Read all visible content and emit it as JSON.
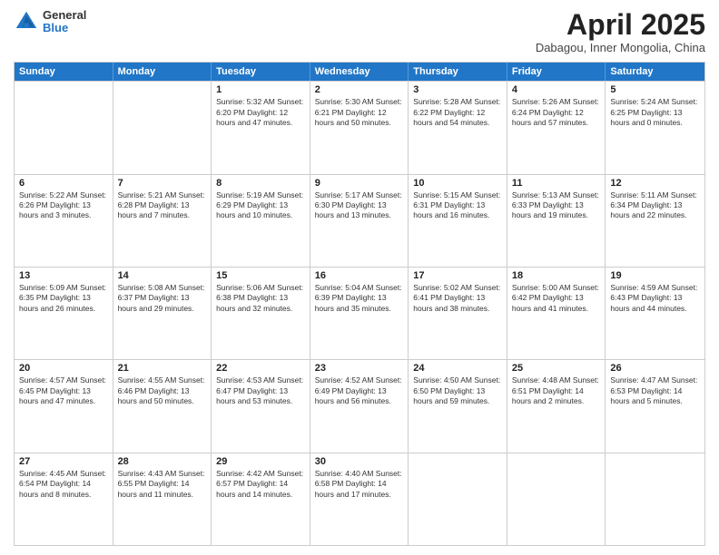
{
  "header": {
    "logo": {
      "general": "General",
      "blue": "Blue"
    },
    "title": "April 2025",
    "location": "Dabagou, Inner Mongolia, China"
  },
  "days_of_week": [
    "Sunday",
    "Monday",
    "Tuesday",
    "Wednesday",
    "Thursday",
    "Friday",
    "Saturday"
  ],
  "weeks": [
    [
      {
        "day": "",
        "info": ""
      },
      {
        "day": "",
        "info": ""
      },
      {
        "day": "1",
        "info": "Sunrise: 5:32 AM\nSunset: 6:20 PM\nDaylight: 12 hours and 47 minutes."
      },
      {
        "day": "2",
        "info": "Sunrise: 5:30 AM\nSunset: 6:21 PM\nDaylight: 12 hours and 50 minutes."
      },
      {
        "day": "3",
        "info": "Sunrise: 5:28 AM\nSunset: 6:22 PM\nDaylight: 12 hours and 54 minutes."
      },
      {
        "day": "4",
        "info": "Sunrise: 5:26 AM\nSunset: 6:24 PM\nDaylight: 12 hours and 57 minutes."
      },
      {
        "day": "5",
        "info": "Sunrise: 5:24 AM\nSunset: 6:25 PM\nDaylight: 13 hours and 0 minutes."
      }
    ],
    [
      {
        "day": "6",
        "info": "Sunrise: 5:22 AM\nSunset: 6:26 PM\nDaylight: 13 hours and 3 minutes."
      },
      {
        "day": "7",
        "info": "Sunrise: 5:21 AM\nSunset: 6:28 PM\nDaylight: 13 hours and 7 minutes."
      },
      {
        "day": "8",
        "info": "Sunrise: 5:19 AM\nSunset: 6:29 PM\nDaylight: 13 hours and 10 minutes."
      },
      {
        "day": "9",
        "info": "Sunrise: 5:17 AM\nSunset: 6:30 PM\nDaylight: 13 hours and 13 minutes."
      },
      {
        "day": "10",
        "info": "Sunrise: 5:15 AM\nSunset: 6:31 PM\nDaylight: 13 hours and 16 minutes."
      },
      {
        "day": "11",
        "info": "Sunrise: 5:13 AM\nSunset: 6:33 PM\nDaylight: 13 hours and 19 minutes."
      },
      {
        "day": "12",
        "info": "Sunrise: 5:11 AM\nSunset: 6:34 PM\nDaylight: 13 hours and 22 minutes."
      }
    ],
    [
      {
        "day": "13",
        "info": "Sunrise: 5:09 AM\nSunset: 6:35 PM\nDaylight: 13 hours and 26 minutes."
      },
      {
        "day": "14",
        "info": "Sunrise: 5:08 AM\nSunset: 6:37 PM\nDaylight: 13 hours and 29 minutes."
      },
      {
        "day": "15",
        "info": "Sunrise: 5:06 AM\nSunset: 6:38 PM\nDaylight: 13 hours and 32 minutes."
      },
      {
        "day": "16",
        "info": "Sunrise: 5:04 AM\nSunset: 6:39 PM\nDaylight: 13 hours and 35 minutes."
      },
      {
        "day": "17",
        "info": "Sunrise: 5:02 AM\nSunset: 6:41 PM\nDaylight: 13 hours and 38 minutes."
      },
      {
        "day": "18",
        "info": "Sunrise: 5:00 AM\nSunset: 6:42 PM\nDaylight: 13 hours and 41 minutes."
      },
      {
        "day": "19",
        "info": "Sunrise: 4:59 AM\nSunset: 6:43 PM\nDaylight: 13 hours and 44 minutes."
      }
    ],
    [
      {
        "day": "20",
        "info": "Sunrise: 4:57 AM\nSunset: 6:45 PM\nDaylight: 13 hours and 47 minutes."
      },
      {
        "day": "21",
        "info": "Sunrise: 4:55 AM\nSunset: 6:46 PM\nDaylight: 13 hours and 50 minutes."
      },
      {
        "day": "22",
        "info": "Sunrise: 4:53 AM\nSunset: 6:47 PM\nDaylight: 13 hours and 53 minutes."
      },
      {
        "day": "23",
        "info": "Sunrise: 4:52 AM\nSunset: 6:49 PM\nDaylight: 13 hours and 56 minutes."
      },
      {
        "day": "24",
        "info": "Sunrise: 4:50 AM\nSunset: 6:50 PM\nDaylight: 13 hours and 59 minutes."
      },
      {
        "day": "25",
        "info": "Sunrise: 4:48 AM\nSunset: 6:51 PM\nDaylight: 14 hours and 2 minutes."
      },
      {
        "day": "26",
        "info": "Sunrise: 4:47 AM\nSunset: 6:53 PM\nDaylight: 14 hours and 5 minutes."
      }
    ],
    [
      {
        "day": "27",
        "info": "Sunrise: 4:45 AM\nSunset: 6:54 PM\nDaylight: 14 hours and 8 minutes."
      },
      {
        "day": "28",
        "info": "Sunrise: 4:43 AM\nSunset: 6:55 PM\nDaylight: 14 hours and 11 minutes."
      },
      {
        "day": "29",
        "info": "Sunrise: 4:42 AM\nSunset: 6:57 PM\nDaylight: 14 hours and 14 minutes."
      },
      {
        "day": "30",
        "info": "Sunrise: 4:40 AM\nSunset: 6:58 PM\nDaylight: 14 hours and 17 minutes."
      },
      {
        "day": "",
        "info": ""
      },
      {
        "day": "",
        "info": ""
      },
      {
        "day": "",
        "info": ""
      }
    ]
  ]
}
